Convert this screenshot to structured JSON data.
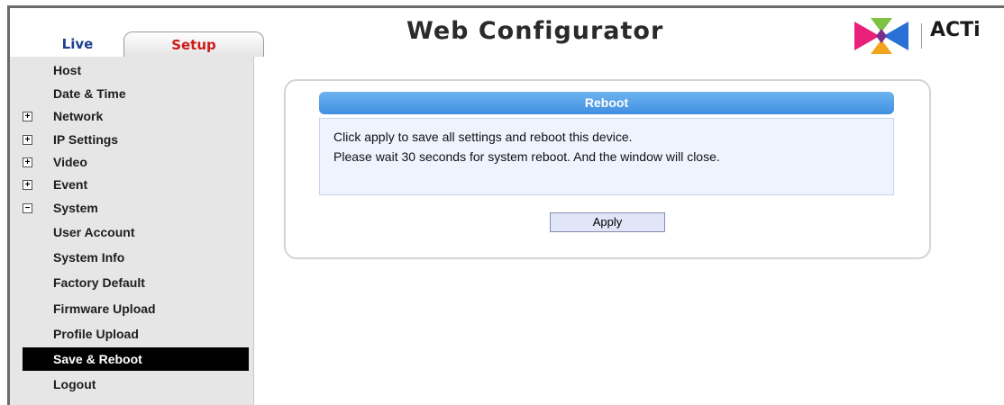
{
  "header": {
    "tabs": [
      {
        "label": "Live"
      },
      {
        "label": "Setup"
      }
    ],
    "title": "Web Configurator",
    "logo_text": "ACTi"
  },
  "sidebar": {
    "items": [
      {
        "label": "Host",
        "expander": ""
      },
      {
        "label": "Date & Time",
        "expander": ""
      },
      {
        "label": "Network",
        "expander": "+"
      },
      {
        "label": "IP Settings",
        "expander": "+"
      },
      {
        "label": "Video",
        "expander": "+"
      },
      {
        "label": "Event",
        "expander": "+"
      },
      {
        "label": "System",
        "expander": "−"
      },
      {
        "label": "User Account",
        "expander": ""
      },
      {
        "label": "System Info",
        "expander": ""
      },
      {
        "label": "Factory Default",
        "expander": ""
      },
      {
        "label": "Firmware Upload",
        "expander": ""
      },
      {
        "label": "Profile Upload",
        "expander": ""
      },
      {
        "label": "Save & Reboot",
        "expander": "",
        "active": true
      },
      {
        "label": "Logout",
        "expander": ""
      }
    ]
  },
  "main": {
    "section_title": "Reboot",
    "messages": [
      "Click apply to save all settings and reboot this device.",
      "Please wait 30 seconds for system reboot. And the window will close."
    ],
    "apply_label": "Apply"
  },
  "colors": {
    "setup_tab_text": "#cc1b1b",
    "live_tab_text": "#1f3f8f",
    "section_bar": "#4a9ae6",
    "active_nav_bg": "#000000"
  }
}
